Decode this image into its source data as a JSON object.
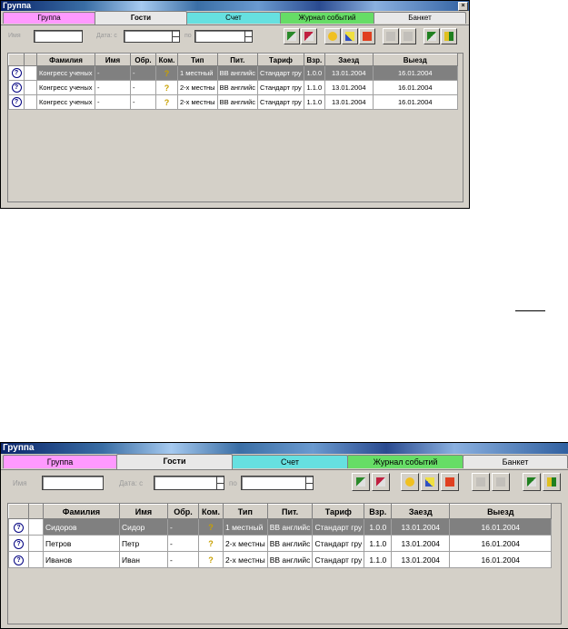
{
  "window_title": "Группа",
  "tabs": [
    {
      "label": "Группа",
      "color": "#ff99ff"
    },
    {
      "label": "Гости",
      "color": "#e8e8e8"
    },
    {
      "label": "Счет",
      "color": "#66e0e0"
    },
    {
      "label": "Журнал событий",
      "color": "#66dd66"
    },
    {
      "label": "Банкет",
      "color": "#e8e8e8"
    }
  ],
  "filters": {
    "name_label": "Имя",
    "date_from_label": "Дата: с",
    "date_to_label": "по"
  },
  "toolbar_icons": [
    "add-guest-icon",
    "remove-guest-icon",
    "info-icon",
    "edit-icon",
    "print-icon",
    "disabled-icon-1",
    "disabled-icon-2",
    "export-icon",
    "exit-icon"
  ],
  "columns": [
    "",
    "",
    "Фамилия",
    "Имя",
    "Обр.",
    "Ком.",
    "Тип",
    "Пит.",
    "Тариф",
    "Взр.",
    "Заезд",
    "Выезд"
  ],
  "window1": {
    "rows": [
      {
        "surname": "Конгресс ученых",
        "name": "-",
        "title": "-",
        "com": "?",
        "type": "1 местный",
        "meal": "BB английс",
        "tariff": "Стандарт гру",
        "adults": "1.0.0",
        "arrival": "13.01.2004",
        "departure": "16.01.2004",
        "selected": true
      },
      {
        "surname": "Конгресс ученых",
        "name": "-",
        "title": "-",
        "com": "?",
        "type": "2-х местны",
        "meal": "BB английс",
        "tariff": "Стандарт гру",
        "adults": "1.1.0",
        "arrival": "13.01.2004",
        "departure": "16.01.2004",
        "selected": false
      },
      {
        "surname": "Конгресс ученых",
        "name": "-",
        "title": "-",
        "com": "?",
        "type": "2-х местны",
        "meal": "BB английс",
        "tariff": "Стандарт гру",
        "adults": "1.1.0",
        "arrival": "13.01.2004",
        "departure": "16.01.2004",
        "selected": false
      }
    ]
  },
  "window2": {
    "rows": [
      {
        "surname": "Сидоров",
        "name": "Сидор",
        "title": "-",
        "com": "?",
        "type": "1 местный",
        "meal": "BB английс",
        "tariff": "Стандарт гру",
        "adults": "1.0.0",
        "arrival": "13.01.2004",
        "departure": "16.01.2004",
        "selected": true
      },
      {
        "surname": "Петров",
        "name": "Петр",
        "title": "-",
        "com": "?",
        "type": "2-х местны",
        "meal": "BB английс",
        "tariff": "Стандарт гру",
        "adults": "1.1.0",
        "arrival": "13.01.2004",
        "departure": "16.01.2004",
        "selected": false
      },
      {
        "surname": "Иванов",
        "name": "Иван",
        "title": "-",
        "com": "?",
        "type": "2-х местны",
        "meal": "BB английс",
        "tariff": "Стандарт гру",
        "adults": "1.1.0",
        "arrival": "13.01.2004",
        "departure": "16.01.2004",
        "selected": false
      }
    ]
  },
  "colors": {
    "selection": "#808080",
    "window_bg": "#d4d0c8",
    "title_bar": "#0a246a"
  }
}
